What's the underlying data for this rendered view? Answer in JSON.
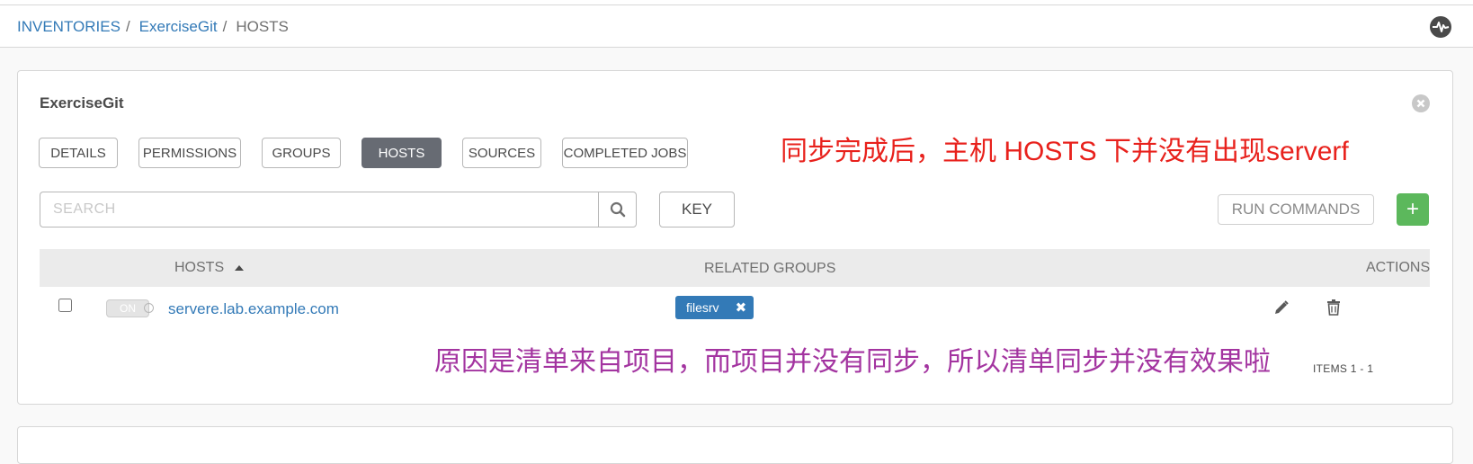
{
  "breadcrumb": {
    "items": [
      {
        "label": "INVENTORIES"
      },
      {
        "label": "ExerciseGit"
      },
      {
        "label": "HOSTS"
      }
    ],
    "separator": "/"
  },
  "icons": {
    "activity": "activity-stream-icon",
    "close": "close-icon",
    "search": "search-icon",
    "edit": "pencil-icon",
    "delete": "trash-icon"
  },
  "panel": {
    "title": "ExerciseGit",
    "tabs": [
      {
        "label": "DETAILS"
      },
      {
        "label": "PERMISSIONS"
      },
      {
        "label": "GROUPS"
      },
      {
        "label": "HOSTS",
        "active": true
      },
      {
        "label": "SOURCES"
      },
      {
        "label": "COMPLETED JOBS"
      }
    ]
  },
  "annotations": {
    "top": "同步完成后，主机 HOSTS 下并没有出现serverf",
    "bottom": "原因是清单来自项目，而项目并没有同步，所以清单同步并没有效果啦"
  },
  "toolbar": {
    "search_placeholder": "SEARCH",
    "key_label": "KEY",
    "run_commands_label": "RUN COMMANDS",
    "add_label": "+"
  },
  "table": {
    "columns": {
      "hosts": "HOSTS",
      "related_groups": "RELATED GROUPS",
      "actions": "ACTIONS"
    },
    "rows": [
      {
        "toggle_label": "ON",
        "host": "servere.lab.example.com",
        "groups": [
          {
            "label": "filesrv",
            "remove": "✖"
          }
        ]
      }
    ]
  },
  "pagination": {
    "items_label": "ITEMS  1 - 1"
  },
  "colors": {
    "link": "#337ab7",
    "active_tab": "#676b73",
    "add_button": "#5cb85c",
    "annotation_top": "#e8211c",
    "annotation_bottom": "#a334a0"
  }
}
